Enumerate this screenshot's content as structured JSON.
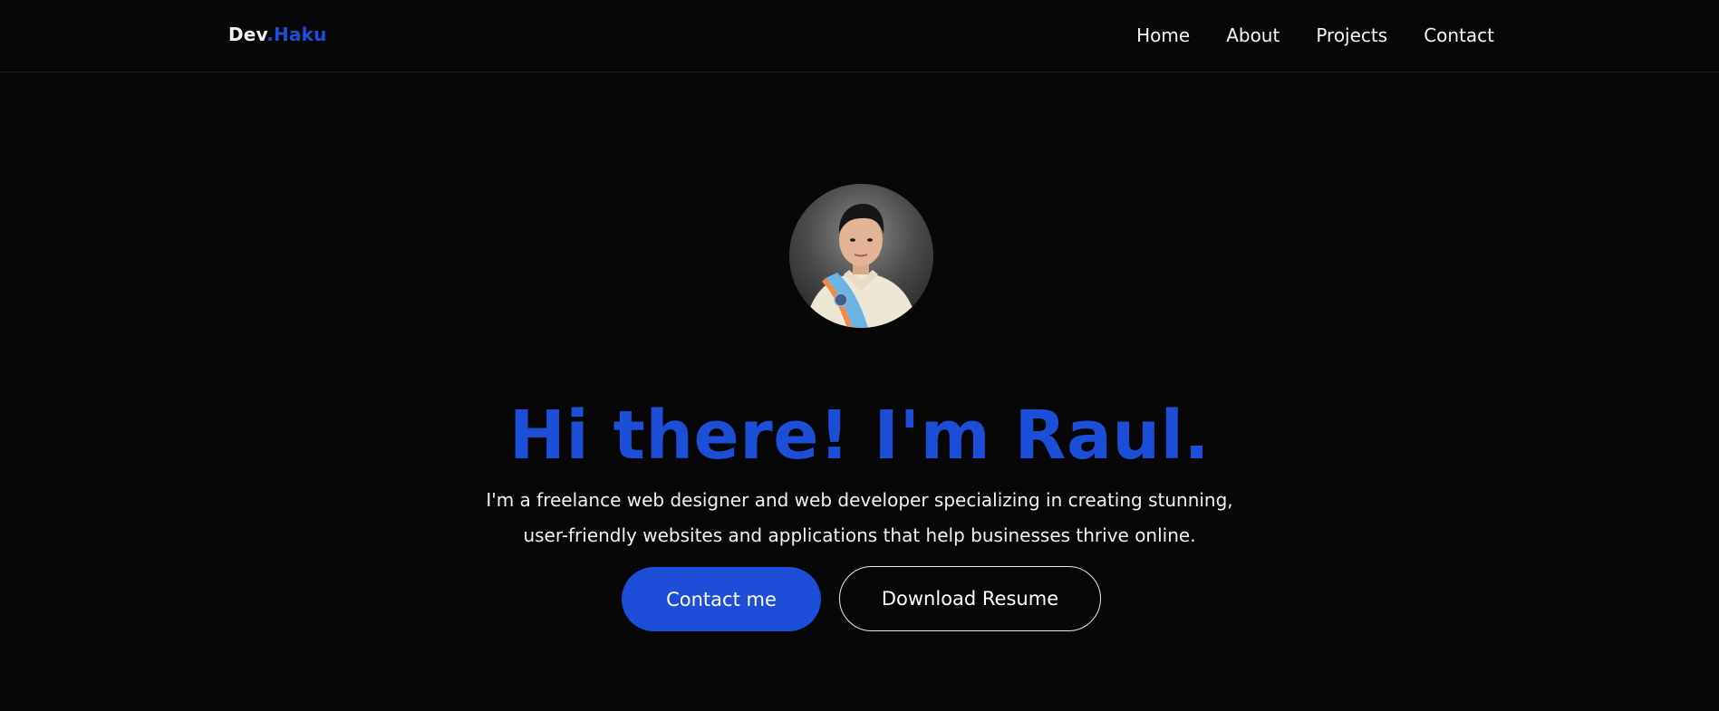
{
  "header": {
    "logo": {
      "part1": "Dev",
      "part2": ".Haku"
    },
    "nav": [
      {
        "label": "Home"
      },
      {
        "label": "About"
      },
      {
        "label": "Projects"
      },
      {
        "label": "Contact"
      }
    ]
  },
  "hero": {
    "avatar_alt": "profile-photo",
    "headline": "Hi there! I'm Raul.",
    "intro_line1": "I'm a freelance web designer and web developer specializing in creating stunning,",
    "intro_line2": "user-friendly websites and applications that help businesses thrive online.",
    "buttons": {
      "contact": "Contact me",
      "resume": "Download Resume"
    }
  },
  "colors": {
    "background": "#070707",
    "accent": "#1d4ed8",
    "text": "#ffffff"
  }
}
